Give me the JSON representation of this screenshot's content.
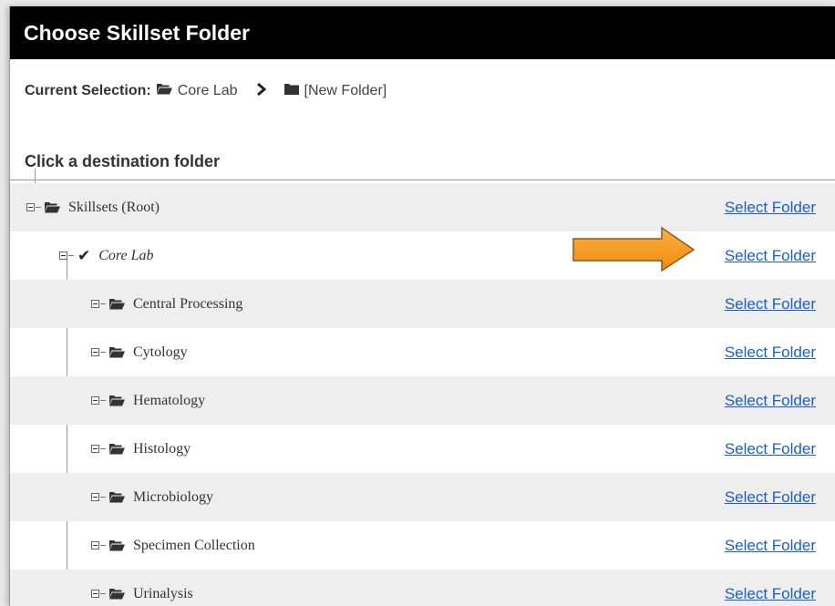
{
  "dialog": {
    "title": "Choose Skillset Folder"
  },
  "current_selection": {
    "label": "Current Selection:",
    "path": [
      "Core Lab",
      "[New Folder]"
    ],
    "separator_icon": "chevron-right-icon"
  },
  "heading": "Click a destination folder",
  "tree": {
    "root": {
      "label": "Skillsets (Root)",
      "icon": "folder-open-icon",
      "action": "Select Folder"
    },
    "selected": {
      "label": "Core Lab",
      "icon": "checkmark-icon",
      "action": "Select Folder"
    },
    "children": [
      {
        "label": "Central Processing",
        "icon": "folder-open-icon",
        "action": "Select Folder"
      },
      {
        "label": "Cytology",
        "icon": "folder-open-icon",
        "action": "Select Folder"
      },
      {
        "label": "Hematology",
        "icon": "folder-open-icon",
        "action": "Select Folder"
      },
      {
        "label": "Histology",
        "icon": "folder-open-icon",
        "action": "Select Folder"
      },
      {
        "label": "Microbiology",
        "icon": "folder-open-icon",
        "action": "Select Folder"
      },
      {
        "label": "Specimen Collection",
        "icon": "folder-open-icon",
        "action": "Select Folder"
      },
      {
        "label": "Urinalysis",
        "icon": "folder-open-icon",
        "action": "Select Folder"
      }
    ]
  },
  "annotation": {
    "type": "arrow",
    "color": "#f7941d",
    "border": "#8a5a1a"
  },
  "colors": {
    "title_bg": "#000000",
    "link": "#1a5fc8",
    "row_shade": "#eeeeee"
  }
}
